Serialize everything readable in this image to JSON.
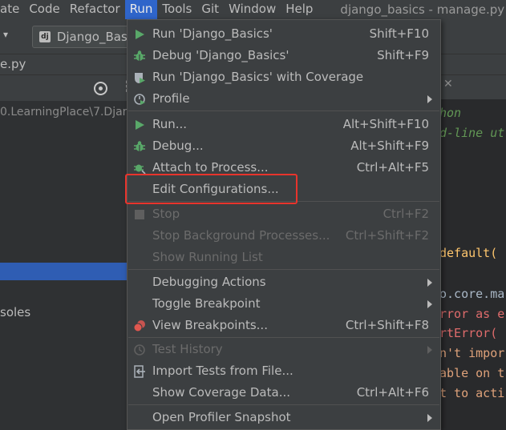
{
  "menubar": {
    "items": [
      "ate",
      "Code",
      "Refactor",
      "Run",
      "Tools",
      "Git",
      "Window",
      "Help"
    ],
    "active_item": "Run",
    "window_title": "django_basics - manage.py"
  },
  "toolbar": {
    "run_config_label": "Django_Basics",
    "run_config_icon": "django-icon"
  },
  "filetabs": {
    "partial_filename": "e.py"
  },
  "project_panel": {
    "path": "0.LearningPlace\\7.Djan",
    "consoles_label": "soles"
  },
  "editor": {
    "lines": [
      {
        "text": "hon",
        "kind": "comment"
      },
      {
        "text": "d-line ut",
        "kind": "comment"
      },
      {
        "text": "default(",
        "kind": "func"
      },
      {
        "text": "o.core.ma",
        "kind": "plain"
      },
      {
        "text": "rror as e",
        "kind": "class"
      },
      {
        "text": "rtError(",
        "kind": "class"
      },
      {
        "text": "n't impor",
        "kind": "string"
      },
      {
        "text": "able on t",
        "kind": "string"
      },
      {
        "text": "t to acti",
        "kind": "string"
      }
    ]
  },
  "run_menu": {
    "items": [
      {
        "label": "Run 'Django_Basics'",
        "shortcut": "Shift+F10",
        "icon": "run-icon",
        "submenu": false,
        "disabled": false
      },
      {
        "label": "Debug 'Django_Basics'",
        "shortcut": "Shift+F9",
        "icon": "debug-icon",
        "submenu": false,
        "disabled": false
      },
      {
        "label": "Run 'Django_Basics' with Coverage",
        "shortcut": "",
        "icon": "coverage-icon",
        "submenu": false,
        "disabled": false
      },
      {
        "label": "Profile",
        "shortcut": "",
        "icon": "profile-icon",
        "submenu": true,
        "disabled": false
      },
      {
        "label": "Run...",
        "shortcut": "Alt+Shift+F10",
        "icon": "run-icon",
        "submenu": false,
        "disabled": false
      },
      {
        "label": "Debug...",
        "shortcut": "Alt+Shift+F9",
        "icon": "debug-icon",
        "submenu": false,
        "disabled": false
      },
      {
        "label": "Attach to Process...",
        "shortcut": "Ctrl+Alt+F5",
        "icon": "attach-icon",
        "submenu": false,
        "disabled": false
      },
      {
        "label": "Edit Configurations...",
        "shortcut": "",
        "icon": "",
        "submenu": false,
        "disabled": false
      },
      {
        "label": "Stop",
        "shortcut": "Ctrl+F2",
        "icon": "stop-icon",
        "submenu": false,
        "disabled": true
      },
      {
        "label": "Stop Background Processes...",
        "shortcut": "Ctrl+Shift+F2",
        "icon": "",
        "submenu": false,
        "disabled": true
      },
      {
        "label": "Show Running List",
        "shortcut": "",
        "icon": "",
        "submenu": false,
        "disabled": true
      },
      {
        "label": "Debugging Actions",
        "shortcut": "",
        "icon": "",
        "submenu": true,
        "disabled": false
      },
      {
        "label": "Toggle Breakpoint",
        "shortcut": "",
        "icon": "",
        "submenu": true,
        "disabled": false
      },
      {
        "label": "View Breakpoints...",
        "shortcut": "Ctrl+Shift+F8",
        "icon": "breakpoints-icon",
        "submenu": false,
        "disabled": false
      },
      {
        "label": "Test History",
        "shortcut": "",
        "icon": "history-icon",
        "submenu": true,
        "disabled": true
      },
      {
        "label": "Import Tests from File...",
        "shortcut": "",
        "icon": "import-icon",
        "submenu": false,
        "disabled": false
      },
      {
        "label": "Show Coverage Data...",
        "shortcut": "Ctrl+Alt+F6",
        "icon": "",
        "submenu": false,
        "disabled": false
      },
      {
        "label": "Open Profiler Snapshot",
        "shortcut": "",
        "icon": "",
        "submenu": true,
        "disabled": false
      }
    ]
  },
  "colors": {
    "accent": "#2f65ca",
    "highlight_box": "#e8342c",
    "run_green": "#59a869"
  }
}
